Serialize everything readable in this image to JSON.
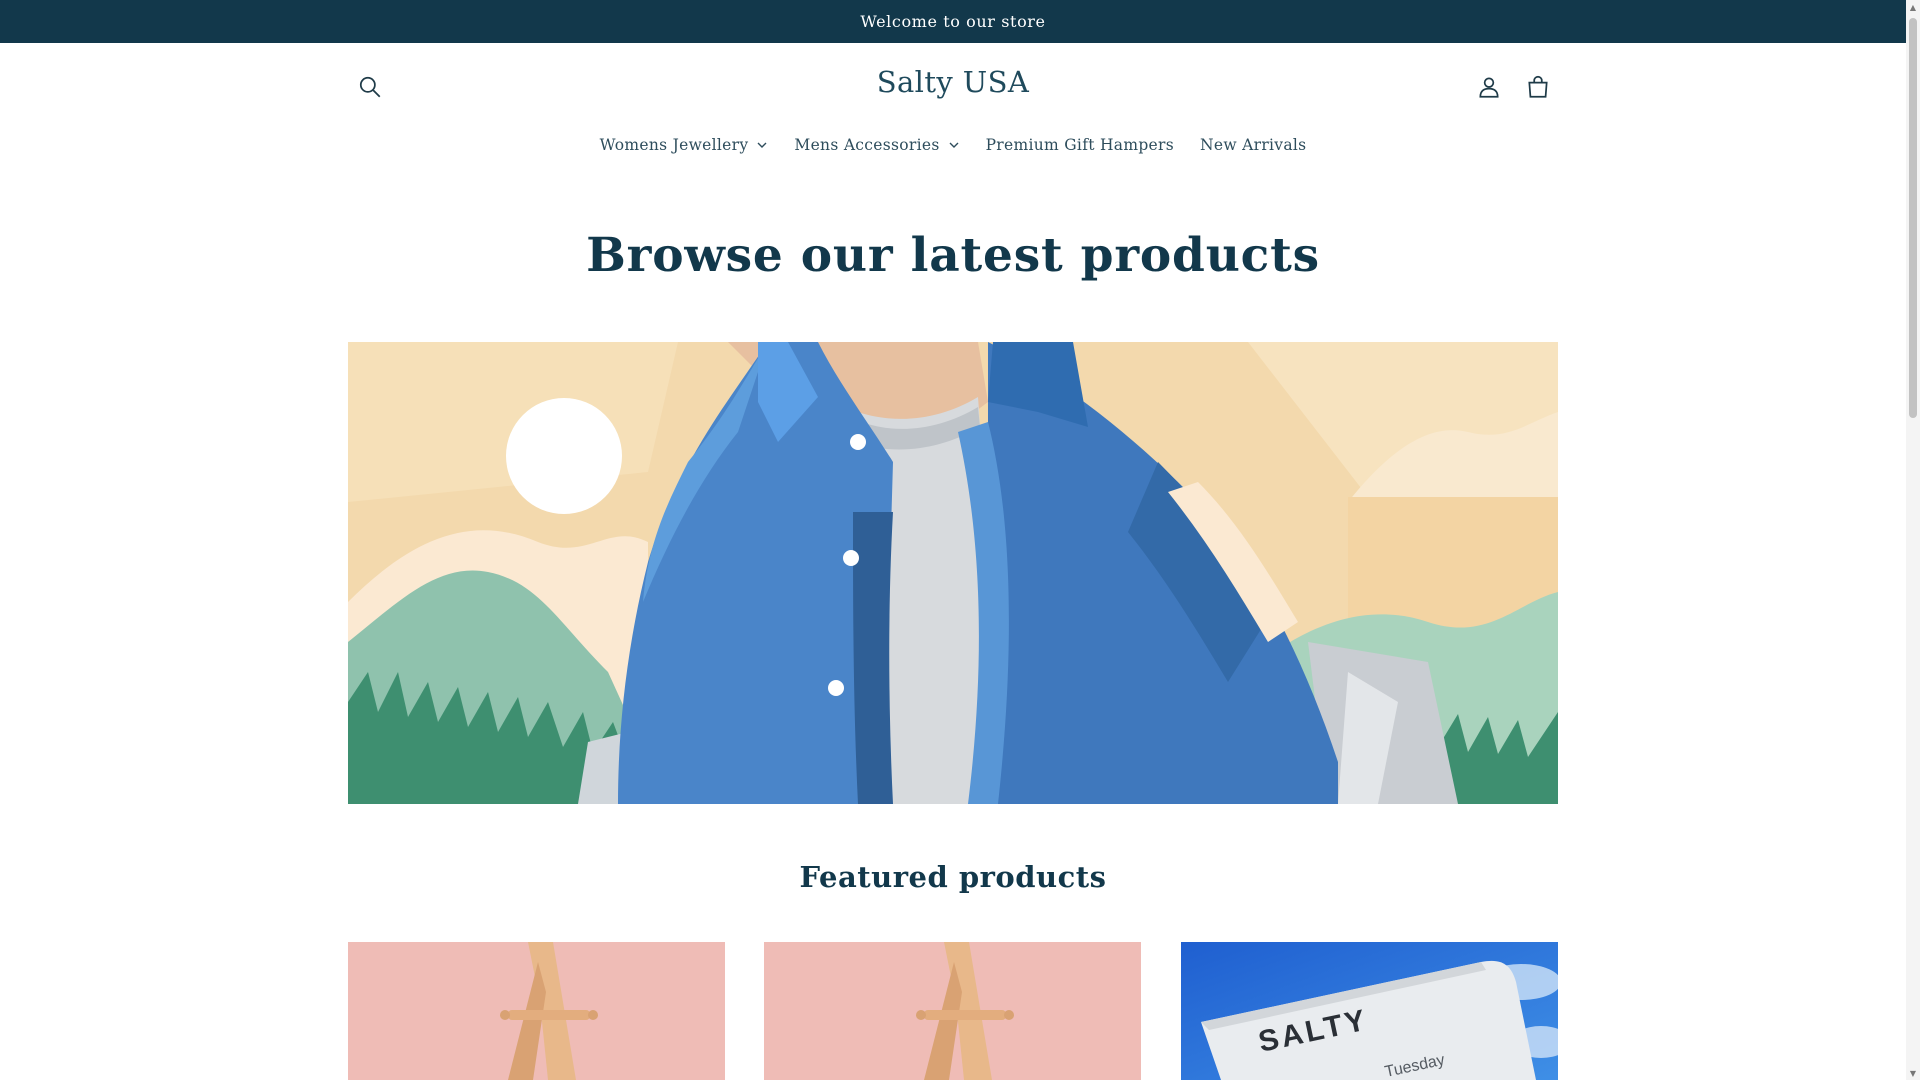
{
  "announcement": {
    "text": "Welcome to our store"
  },
  "header": {
    "logo": "Salty USA",
    "icons": [
      "search-icon",
      "account-icon",
      "cart-icon"
    ]
  },
  "nav": {
    "items": [
      {
        "label": "Womens Jewellery",
        "has_dropdown": true
      },
      {
        "label": "Mens Accessories",
        "has_dropdown": true
      },
      {
        "label": "Premium Gift Hampers",
        "has_dropdown": false
      },
      {
        "label": "New Arrivals",
        "has_dropdown": false
      }
    ]
  },
  "hero": {
    "title": "Browse our latest products"
  },
  "featured": {
    "title": "Featured products",
    "products": [
      {
        "image": "pink-easel-photo"
      },
      {
        "image": "pink-easel-photo"
      },
      {
        "image": "salty-card-sky-photo",
        "card_brand": "SALTY",
        "card_day": "Tuesday"
      }
    ]
  },
  "colors": {
    "announcement_bg": "#12384b",
    "text_primary": "#12384b",
    "jacket_blue": "#4a85c9",
    "hill_green": "#8fc2ad",
    "sand": "#f3d9ad"
  }
}
